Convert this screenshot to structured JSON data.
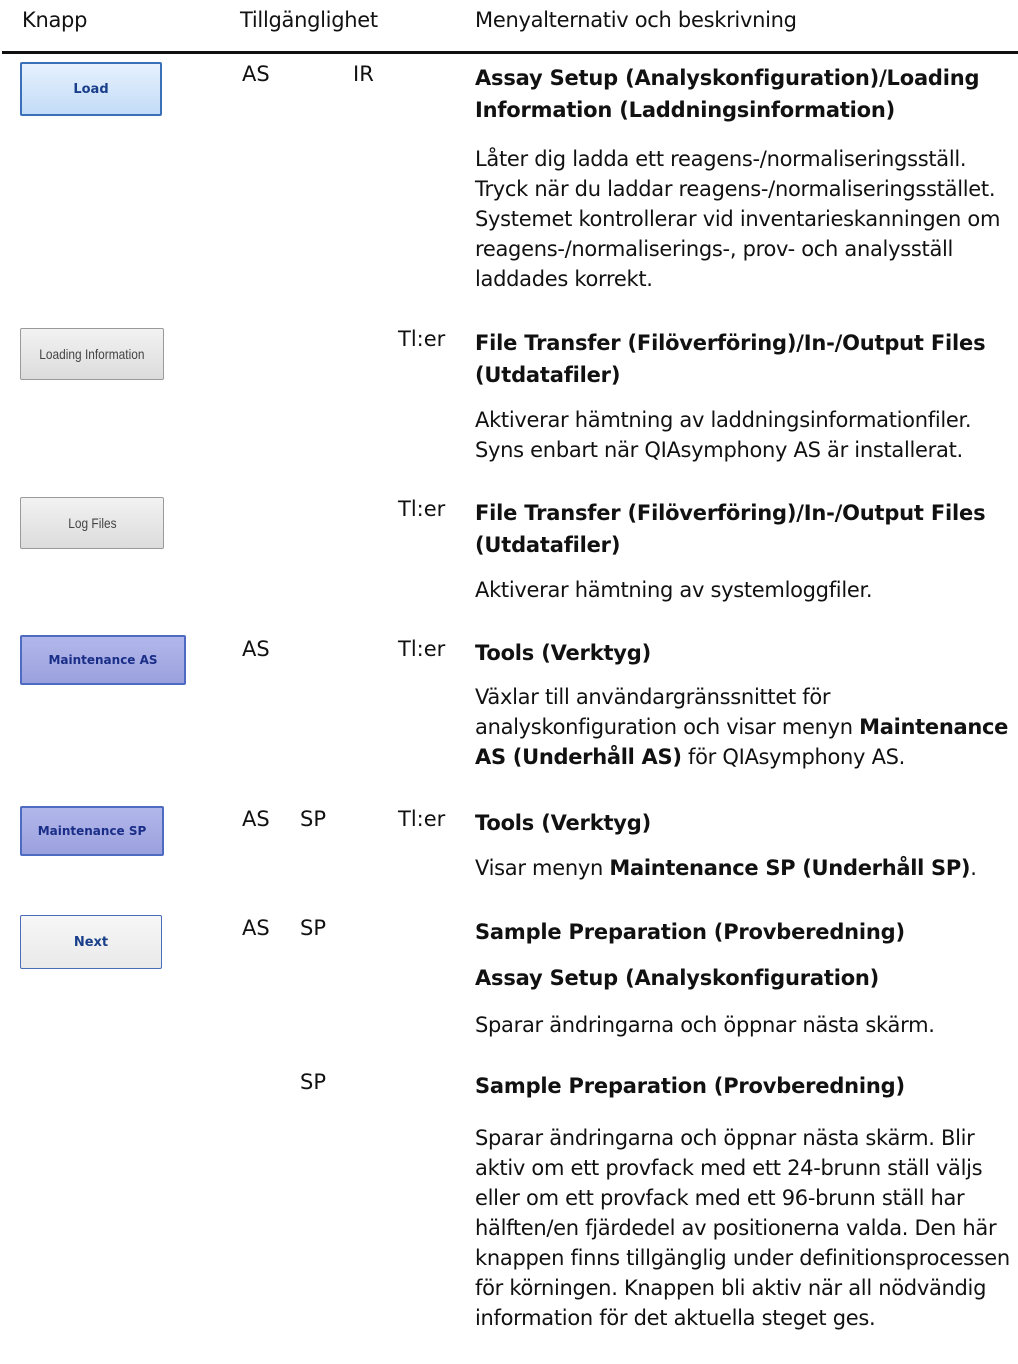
{
  "header": {
    "col1": "Knapp",
    "col2": "Tillgänglighet",
    "col3": "Menyalternativ och beskrivning"
  },
  "rows": [
    {
      "button": "Load",
      "avail_as": "AS",
      "avail_sp": "",
      "avail_ir": "IR",
      "avail_tl": "",
      "titles": [
        "Assay Setup (Analyskonfiguration)/Loading Information (Laddningsinformation)"
      ],
      "description": "Låter dig ladda ett reagens-/normaliseringsställ. Tryck när du laddar reagens-/normaliseringsstället. Systemet kontrollerar vid inventarieskanningen om reagens-/normaliserings-, prov- och analysställ laddades korrekt."
    },
    {
      "button": "Loading Information",
      "avail_as": "",
      "avail_sp": "",
      "avail_ir": "",
      "avail_tl": "Tl:er",
      "titles": [
        "File Transfer (Filöverföring)/In-/Output Files (Utdatafiler)"
      ],
      "description": "Aktiverar hämtning av laddningsinformationfiler. Syns enbart när QIAsymphony AS är installerat."
    },
    {
      "button": "Log Files",
      "avail_as": "",
      "avail_sp": "",
      "avail_ir": "",
      "avail_tl": "Tl:er",
      "titles": [
        "File Transfer (Filöverföring)/In-/Output Files (Utdatafiler)"
      ],
      "description": "Aktiverar hämtning av systemloggfiler."
    },
    {
      "button": "Maintenance AS",
      "avail_as": "AS",
      "avail_sp": "",
      "avail_ir": "",
      "avail_tl": "Tl:er",
      "titles": [
        "Tools (Verktyg)"
      ],
      "description_pre": "Växlar till användargränssnittet för analyskonfiguration och visar menyn ",
      "description_bold": "Maintenance AS (Underhåll AS)",
      "description_post": " för QIAsymphony AS."
    },
    {
      "button": "Maintenance SP",
      "avail_as": "AS",
      "avail_sp": "SP",
      "avail_ir": "",
      "avail_tl": "Tl:er",
      "titles": [
        "Tools (Verktyg)"
      ],
      "description_pre": "Visar menyn ",
      "description_bold": "Maintenance SP (Underhåll SP)",
      "description_post": "."
    },
    {
      "button": "Next",
      "avail_as": "AS",
      "avail_sp": "SP",
      "avail_ir": "",
      "avail_tl": "",
      "titles": [
        "Sample Preparation (Provberedning)",
        "Assay Setup (Analyskonfiguration)"
      ],
      "description": "Sparar ändringarna och öppnar nästa skärm."
    },
    {
      "button": "",
      "avail_as": "",
      "avail_sp": "SP",
      "avail_ir": "",
      "avail_tl": "",
      "titles": [
        "Sample Preparation (Provberedning)"
      ],
      "description": "Sparar ändringarna och öppnar nästa skärm. Blir aktiv om ett provfack med ett 24-brunn ställ väljs eller om ett provfack med ett 96-brunn ställ har hälften/en fjärdedel av positionerna valda. Den här knappen finns tillgänglig under definitionsprocessen för körningen. Knappen bli aktiv när all nödvändig information för det aktuella steget ges."
    }
  ]
}
